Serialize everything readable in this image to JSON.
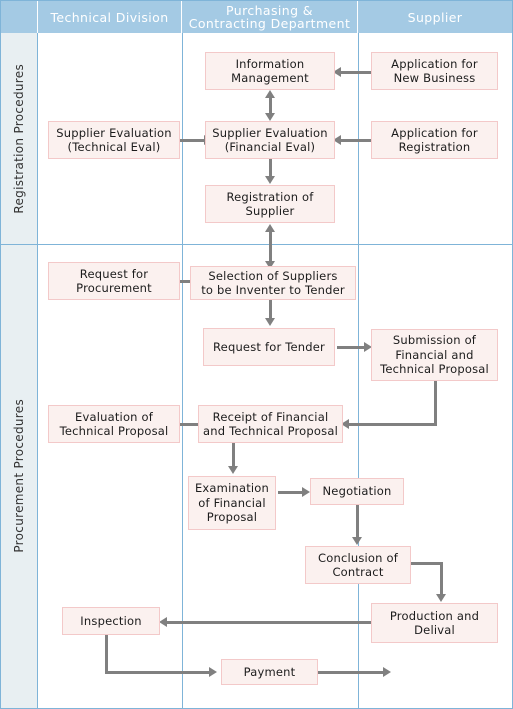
{
  "diagram": {
    "title": "Supplier Registration and Procurement Procedures Flowchart",
    "colors": {
      "header_band": "#a4cae4",
      "header_text": "#ffffff",
      "rail_background": "#e8eff2",
      "grid_line": "#7fb4d8",
      "box_fill": "#fbf1ef",
      "box_border": "#f3c9c9",
      "box_text": "#1c1c1c",
      "connector": "#808080"
    }
  },
  "columns": {
    "corner": "",
    "technical_division": "Technical Division",
    "purchasing_line1": "Purchasing &",
    "purchasing_line2": "Contracting Department",
    "supplier": "Supplier"
  },
  "phases": {
    "registration": "Registration Procedures",
    "procurement": "Procurement Procedures"
  },
  "nodes": {
    "information_management": "Information Management",
    "supplier_eval_technical": "Supplier Evaluation (Technical Eval)",
    "supplier_eval_financial": "Supplier Evaluation (Financial Eval)",
    "registration_of_supplier": "Registration of Supplier",
    "application_new_business": "Application for New Business",
    "application_registration": "Application for Registration",
    "request_for_procurement": "Request for Procurement",
    "selection_of_suppliers": "Selection of Suppliers to be Inventer to Tender",
    "request_for_tender": "Request for Tender",
    "submission_proposal": "Submission of Financial and Technical Proposal",
    "evaluation_technical_proposal": "Evaluation of Technical Proposal",
    "receipt_proposal": "Receipt of Financial and Technical Proposal",
    "examination_financial": "Examination of Financial Proposal",
    "negotiation": "Negotiation",
    "conclusion_of_contract": "Conclusion of Contract",
    "production_and_delival": "Production and Delival",
    "inspection": "Inspection",
    "payment": "Payment"
  },
  "node_lines": {
    "information_management": [
      "Information",
      "Management"
    ],
    "supplier_eval_technical": [
      "Supplier Evaluation",
      "(Technical Eval)"
    ],
    "supplier_eval_financial": [
      "Supplier Evaluation",
      "(Financial Eval)"
    ],
    "registration_of_supplier": [
      "Registration of",
      "Supplier"
    ],
    "application_new_business": [
      "Application for",
      "New Business"
    ],
    "application_registration": [
      "Application for",
      "Registration"
    ],
    "request_for_procurement": [
      "Request for",
      "Procurement"
    ],
    "selection_of_suppliers": [
      "Selection of Suppliers",
      "to be Inventer to Tender"
    ],
    "request_for_tender": [
      "Request for Tender"
    ],
    "submission_proposal": [
      "Submission of",
      "Financial and",
      "Technical Proposal"
    ],
    "evaluation_technical_proposal": [
      "Evaluation of",
      "Technical Proposal"
    ],
    "receipt_proposal": [
      "Receipt of Financial",
      "and Technical Proposal"
    ],
    "examination_financial": [
      "Examination",
      "of Financial",
      "Proposal"
    ],
    "negotiation": [
      "Negotiation"
    ],
    "conclusion_of_contract": [
      "Conclusion of",
      "Contract"
    ],
    "production_and_delival": [
      "Production and",
      "Delival"
    ],
    "inspection": [
      "Inspection"
    ],
    "payment": [
      "Payment"
    ]
  }
}
